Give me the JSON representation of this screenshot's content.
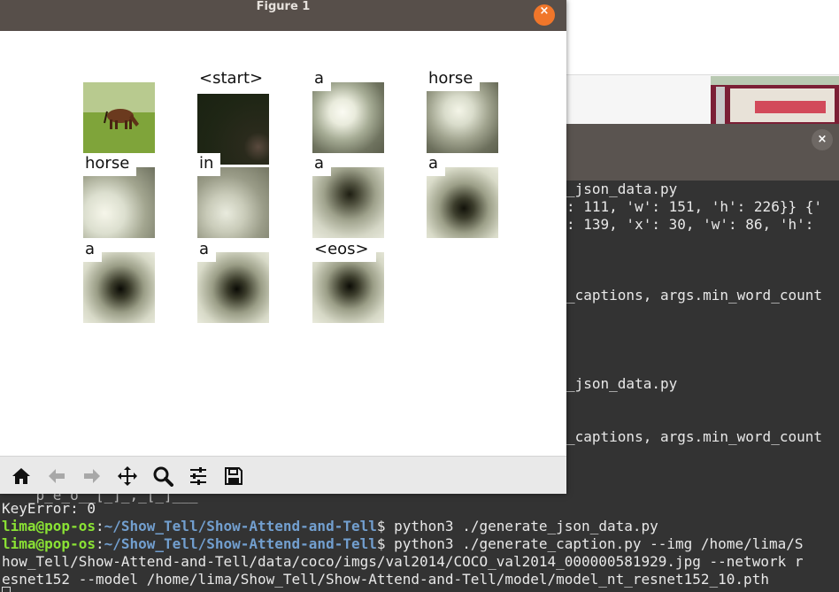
{
  "figure_window": {
    "title": "Figure 1",
    "close_glyph": "×",
    "tiles": [
      {
        "label": ""
      },
      {
        "label": "<start>"
      },
      {
        "label": "a"
      },
      {
        "label": "horse"
      },
      {
        "label": "horse"
      },
      {
        "label": "in"
      },
      {
        "label": "a"
      },
      {
        "label": "a"
      },
      {
        "label": "a"
      },
      {
        "label": "a"
      },
      {
        "label": "<eos>"
      }
    ],
    "toolbar": [
      "home-icon",
      "back-arrow-icon",
      "forward-arrow-icon",
      "pan-icon",
      "zoom-icon",
      "configure-subplots-icon",
      "save-icon"
    ]
  },
  "terminal_right": {
    "close_glyph": "×",
    "lines": [
      "_json_data.py",
      ": 111, 'w': 151, 'h': 226}} {'",
      ": 139, 'x': 30, 'w': 86, 'h':",
      "_captions, args.min_word_count",
      "_json_data.py",
      "_captions, args.min_word_count"
    ]
  },
  "terminal_bottom": {
    "partial_line": "    p_e_o__[_]_,_[_]___",
    "error_line": "KeyError: 0",
    "prompt_user": "lima@pop-os",
    "prompt_sep": ":",
    "prompt_path": "~/Show_Tell/Show-Attend-and-Tell",
    "prompt_dollar": "$",
    "cmd1": " python3 ./generate_json_data.py",
    "cmd2": " python3 ./generate_caption.py --img /home/lima/S",
    "cmd2_wrap1": "how_Tell/Show-Attend-and-Tell/data/coco/imgs/val2014/COCO_val2014_000000581929.jpg --network r",
    "cmd2_wrap2": "esnet152 --model /home/lima/Show_Tell/Show-Attend-and-Tell/model/model_nt_resnet152_10.pth"
  }
}
